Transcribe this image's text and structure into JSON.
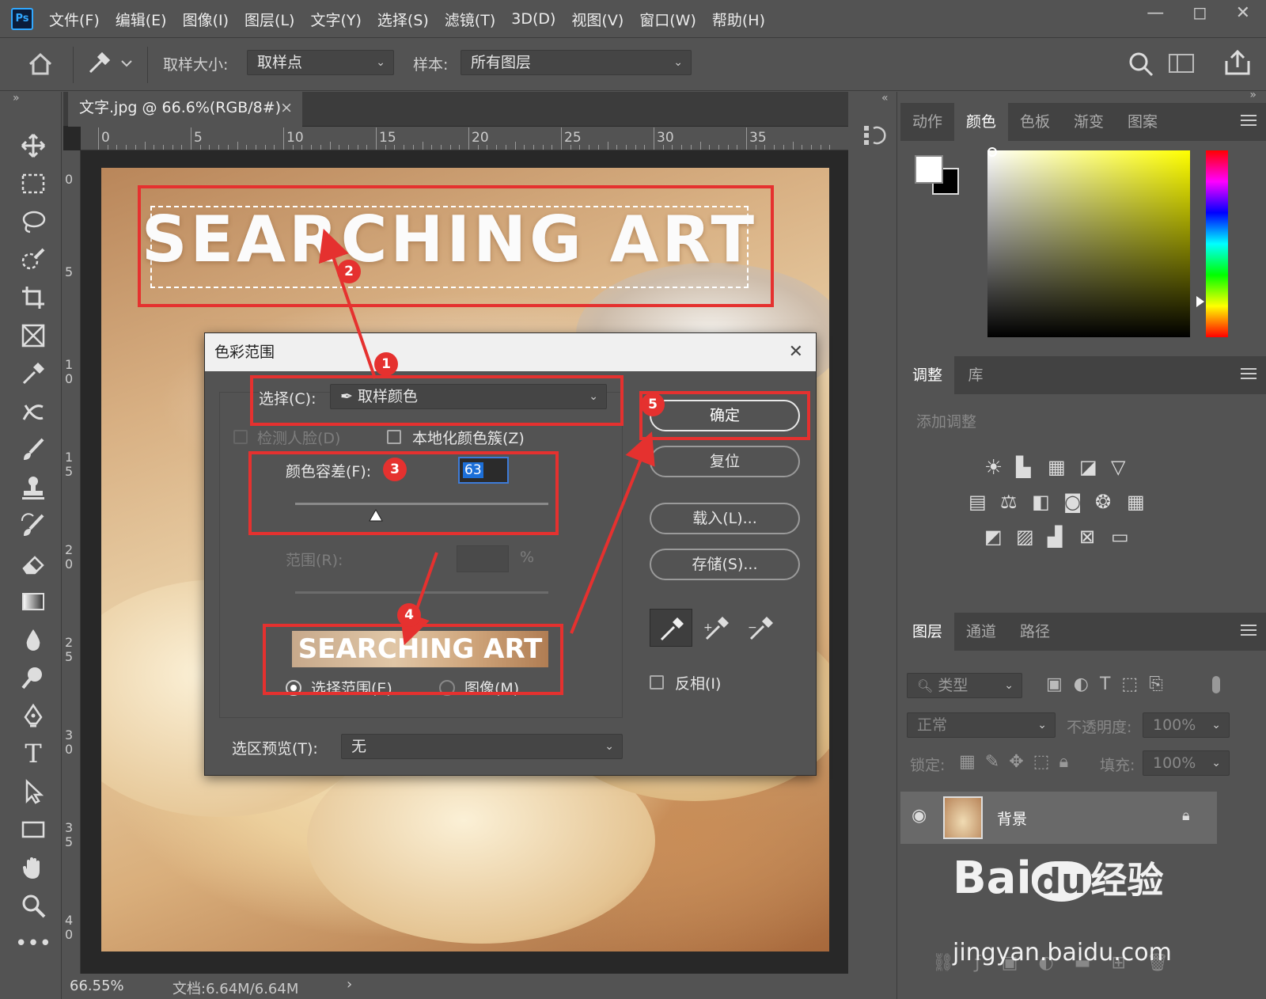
{
  "app": {
    "logo": "Ps"
  },
  "menubar": {
    "items": [
      "文件(F)",
      "编辑(E)",
      "图像(I)",
      "图层(L)",
      "文字(Y)",
      "选择(S)",
      "滤镜(T)",
      "3D(D)",
      "视图(V)",
      "窗口(W)",
      "帮助(H)"
    ]
  },
  "options": {
    "sample_size_label": "取样大小:",
    "sample_size_value": "取样点",
    "sample_label": "样本:",
    "sample_value": "所有图层"
  },
  "document": {
    "tab_title": "文字.jpg @ 66.6%(RGB/8#)",
    "close_glyph": "×",
    "canvas_text": "SEARCHING ART",
    "ruler_top": [
      "0",
      "5",
      "10",
      "15",
      "20",
      "25",
      "30",
      "35"
    ],
    "ruler_left": [
      "0",
      "5",
      "1\n0",
      "1\n5",
      "2\n0",
      "2\n5",
      "3\n0",
      "3\n5",
      "4\n0"
    ]
  },
  "status": {
    "zoom": "66.55%",
    "doc_info": "文档:6.64M/6.64M",
    "arrow": "›"
  },
  "color_range_dialog": {
    "title": "色彩范围",
    "select_label": "选择(C):",
    "select_value": "取样颜色",
    "detect_faces": "检测人脸(D)",
    "localized_clusters": "本地化颜色簇(Z)",
    "fuzziness_label": "颜色容差(F):",
    "fuzziness_value": "63",
    "range_label": "范围(R):",
    "range_unit": "%",
    "preview_text": "SEARCHING ART",
    "radio_selection": "选择范围(E)",
    "radio_image": "图像(M)",
    "selection_preview_label": "选区预览(T):",
    "selection_preview_value": "无",
    "ok": "确定",
    "reset": "复位",
    "load": "载入(L)...",
    "save": "存储(S)...",
    "invert": "反相(I)",
    "fuzziness_slider_fraction": 0.32
  },
  "annotations": {
    "badges": [
      "1",
      "2",
      "3",
      "4",
      "5"
    ]
  },
  "color_panel": {
    "tabs": [
      "动作",
      "颜色",
      "色板",
      "渐变",
      "图案"
    ],
    "active": "颜色"
  },
  "adjust_panel": {
    "tabs": [
      "调整",
      "库"
    ],
    "hint": "添加调整"
  },
  "layers_panel": {
    "tabs": [
      "图层",
      "通道",
      "路径"
    ],
    "filter_label": "类型",
    "blend_mode": "正常",
    "opacity_label": "不透明度:",
    "opacity_value": "100%",
    "lock_label": "锁定:",
    "fill_label": "填充:",
    "fill_value": "100%",
    "layer_name": "背景"
  },
  "watermark": {
    "brand": "Bai",
    "paw": "du",
    "suffix": "经验",
    "url": "jingyan.baidu.com"
  },
  "colors": {
    "accent_red": "#e5312f",
    "ps_blue": "#31a8ff",
    "panel_bg": "#535353"
  }
}
